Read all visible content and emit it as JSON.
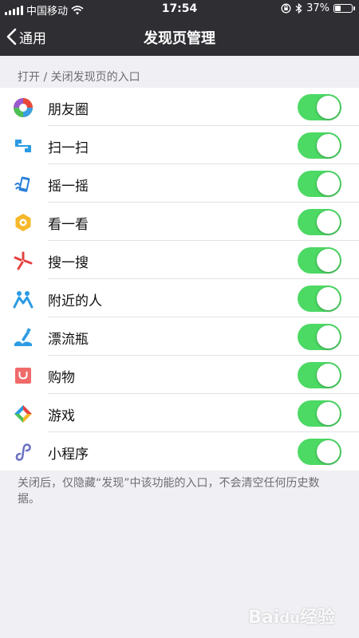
{
  "status_bar": {
    "carrier": "中国移动",
    "time": "17:54",
    "battery_percent": "37%",
    "battery_level": 0.37
  },
  "nav": {
    "back_label": "通用",
    "title": "发现页管理"
  },
  "section_header": "打开 / 关闭发现页的入口",
  "items": [
    {
      "label": "朋友圈",
      "icon": "moments-icon",
      "enabled": true
    },
    {
      "label": "扫一扫",
      "icon": "scan-icon",
      "enabled": true
    },
    {
      "label": "摇一摇",
      "icon": "shake-icon",
      "enabled": true
    },
    {
      "label": "看一看",
      "icon": "top-stories-icon",
      "enabled": true
    },
    {
      "label": "搜一搜",
      "icon": "search-icon",
      "enabled": true
    },
    {
      "label": "附近的人",
      "icon": "people-nearby-icon",
      "enabled": true
    },
    {
      "label": "漂流瓶",
      "icon": "drift-bottle-icon",
      "enabled": true
    },
    {
      "label": "购物",
      "icon": "shopping-icon",
      "enabled": true
    },
    {
      "label": "游戏",
      "icon": "games-icon",
      "enabled": true
    },
    {
      "label": "小程序",
      "icon": "mini-programs-icon",
      "enabled": true
    }
  ],
  "footer_note": "关闭后，仅隐藏“发现”中该功能的入口，不会清空任何历史数据。",
  "watermark": "Baidu经验",
  "colors": {
    "switch_on": "#4cd964",
    "nav_bg": "#2e2e33",
    "page_bg": "#efeff4"
  }
}
